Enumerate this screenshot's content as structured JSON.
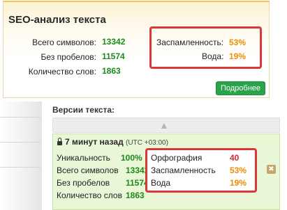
{
  "seo": {
    "title": "SEO-анализ текста",
    "stats": [
      {
        "label": "Всего символов:",
        "value": "13342"
      },
      {
        "label": "Без пробелов:",
        "value": "11574"
      },
      {
        "label": "Количество слов:",
        "value": "1863"
      }
    ],
    "highlight": [
      {
        "label": "Заспамленность:",
        "value": "53%"
      },
      {
        "label": "Вода:",
        "value": "19%"
      }
    ],
    "more_button": "Подробнее"
  },
  "versions": {
    "title": "Версии текста:",
    "card": {
      "time": "7 минут назад",
      "timezone": "(UTC +03:00)",
      "stats": [
        {
          "label": "Уникальность",
          "value": "100%"
        },
        {
          "label": "Всего символов",
          "value": "13342"
        },
        {
          "label": "Без пробелов",
          "value": "11574"
        },
        {
          "label": "Количество слов",
          "value": "1863"
        }
      ],
      "checks": [
        {
          "label": "Орфография",
          "value": "40"
        },
        {
          "label": "Заспамленность",
          "value": "53%"
        },
        {
          "label": "Вода",
          "value": "19%"
        }
      ]
    }
  },
  "colors": {
    "green": "#1a8a1a",
    "orange": "#f08c00",
    "red": "#d92b2b",
    "highlight_border": "#d9373a",
    "button": "#2aa34b"
  },
  "icons": {
    "lock": "lock-icon",
    "collapse": "chevron-up-icon",
    "close": "close-icon"
  }
}
